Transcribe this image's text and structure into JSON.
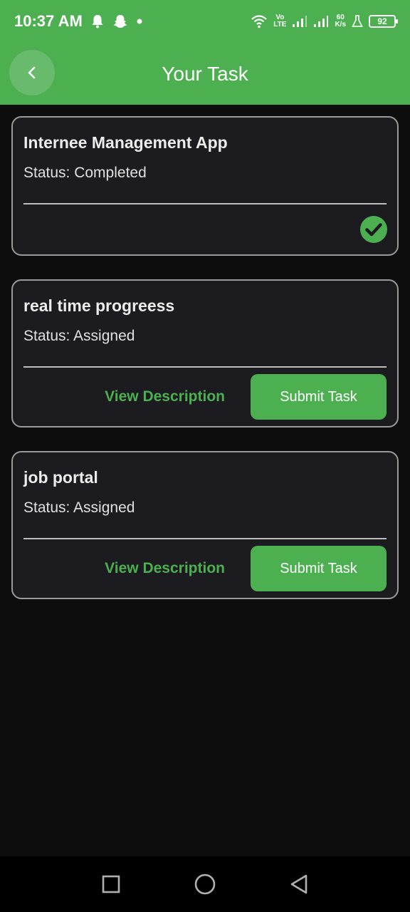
{
  "status_bar": {
    "time": "10:37 AM",
    "network_top": "Vo",
    "network_bottom": "LTE",
    "speed_top": "60",
    "speed_bottom": "K/s",
    "battery": "92"
  },
  "app_bar": {
    "title": "Your Task",
    "back_icon": "chevron-left-icon"
  },
  "tasks": [
    {
      "title": "Internee Management App",
      "status": "Status: Completed",
      "completed": true,
      "completed_icon": "check-circle-icon"
    },
    {
      "title": "real time progreess",
      "status": "Status: Assigned",
      "completed": false,
      "view_label": "View Description",
      "submit_label": "Submit Task"
    },
    {
      "title": "job portal",
      "status": "Status: Assigned",
      "completed": false,
      "view_label": "View Description",
      "submit_label": "Submit Task"
    }
  ],
  "colors": {
    "accent": "#4caf50",
    "background": "#0d0d0d",
    "card": "#1c1b20"
  }
}
